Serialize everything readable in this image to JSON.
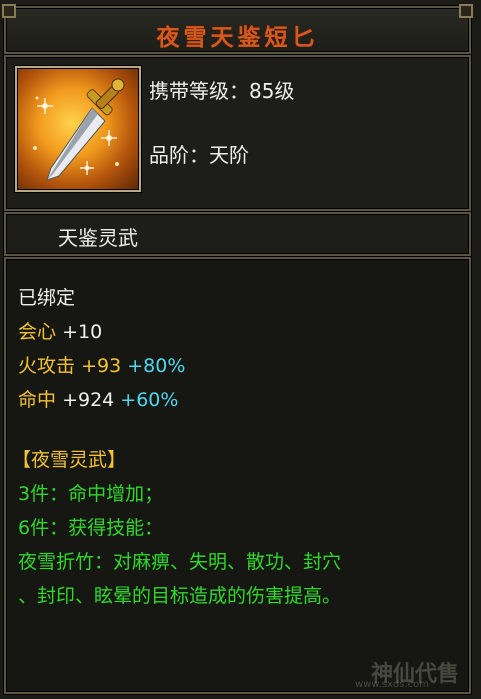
{
  "title": "夜雪天鉴短匕",
  "item": {
    "level_label": "携带等级：",
    "level_value": "85级",
    "grade_label": "品阶：",
    "grade_value": "天阶",
    "icon": "dagger-icon"
  },
  "set_bar_label": "天鉴灵武",
  "details": {
    "bound": "已绑定",
    "stats": [
      {
        "name": "会心",
        "value": "+10",
        "bonus": ""
      },
      {
        "name": "火攻击",
        "value": "+93",
        "bonus": "+80%"
      },
      {
        "name": "命中",
        "value": "+924",
        "bonus": "+60%"
      }
    ],
    "set_title": "【夜雪灵武】",
    "set_lines": [
      "3件：命中增加；",
      "6件：获得技能：",
      "夜雪折竹：对麻痹、失明、散功、封穴",
      "、封印、眩晕的目标造成的伤害提高。"
    ]
  },
  "watermark": {
    "text": "神仙代售",
    "url": "www.sxds.com"
  },
  "colors": {
    "title": "#d45a1f",
    "white": "#f0f0f0",
    "yellow": "#f3c233",
    "cyan": "#4dd7f0",
    "green": "#2fd82b",
    "frame": "#5b5440"
  }
}
